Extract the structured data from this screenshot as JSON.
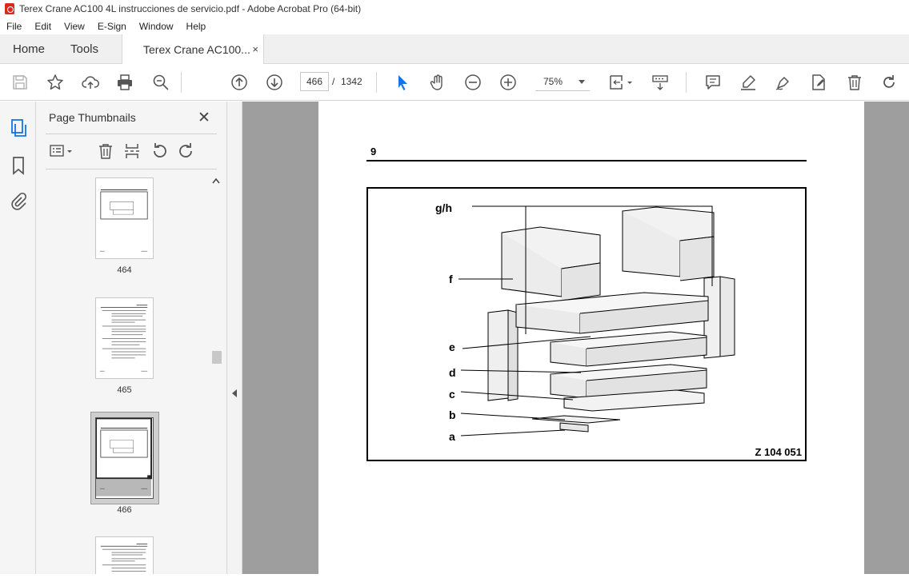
{
  "window": {
    "title": "Terex Crane AC100 4L instrucciones de servicio.pdf - Adobe Acrobat Pro (64-bit)"
  },
  "menu": [
    "File",
    "Edit",
    "View",
    "E-Sign",
    "Window",
    "Help"
  ],
  "tabs": {
    "home": "Home",
    "tools": "Tools",
    "doc": "Terex Crane AC100...",
    "close": "×"
  },
  "toolbar": {
    "page_current": "466",
    "page_sep": "/",
    "page_total": "1342",
    "zoom": "75%"
  },
  "thumbnails": {
    "title": "Page Thumbnails",
    "close": "✕",
    "pages": [
      "464",
      "465",
      "466"
    ],
    "selected": "466"
  },
  "document": {
    "section_number": "9",
    "figure": {
      "labels": {
        "gh": "g/h",
        "f": "f",
        "e": "e",
        "d": "d",
        "c": "c",
        "b": "b",
        "a": "a"
      },
      "figure_id": "Z 104 051"
    }
  },
  "colors": {
    "accent": "#1473e6",
    "canvas": "#9e9e9e",
    "panel": "#f5f5f5"
  }
}
